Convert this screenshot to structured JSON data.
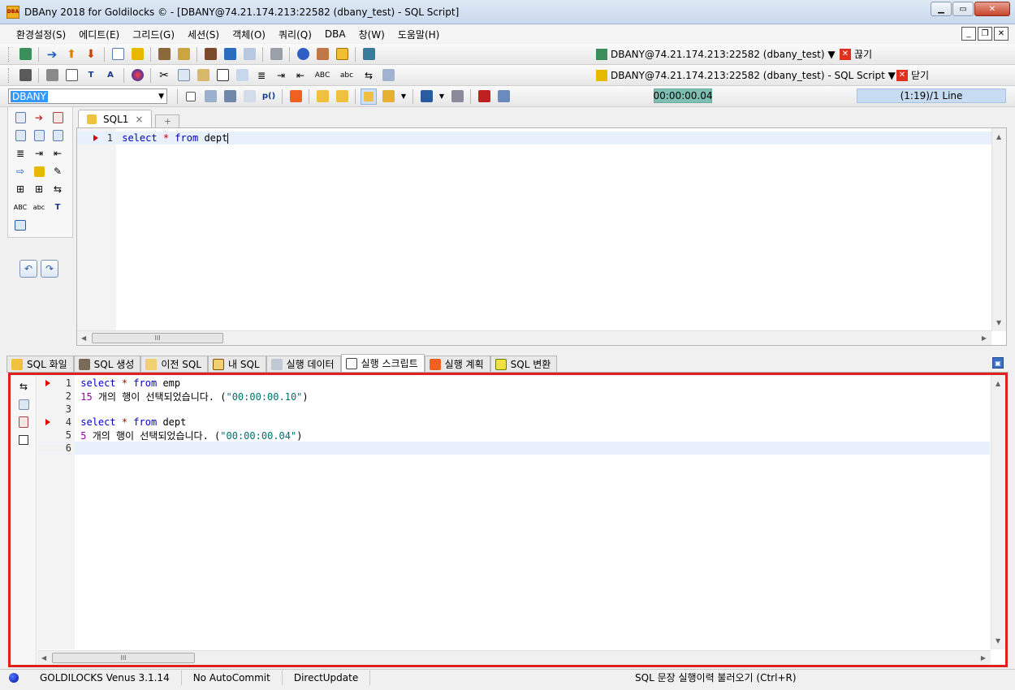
{
  "window": {
    "app_icon": "DBA",
    "title": "DBAny 2018 for Goldilocks © - [DBANY@74.21.174.213:22582 (dbany_test) - SQL Script]"
  },
  "menu": [
    "환경설정(S)",
    "에디트(E)",
    "그리드(G)",
    "세션(S)",
    "객체(O)",
    "쿼리(Q)",
    "DBA",
    "창(W)",
    "도움말(H)"
  ],
  "toolbar_right": {
    "connection": "DBANY@74.21.174.213:22582 (dbany_test) ▼",
    "disconnect": "끊기",
    "script_window": "DBANY@74.21.174.213:22582 (dbany_test) - SQL Script ▼",
    "close": "닫기"
  },
  "toolbar3": {
    "connection_combo": "DBANY",
    "elapsed_time": "00:00:00.04",
    "cursor_position": "(1:19)/1 Line"
  },
  "editor": {
    "tab_label": "SQL1",
    "tab_close": "×",
    "line_no": "1",
    "code": {
      "kw1": "select",
      "op": "*",
      "kw2": "from",
      "ident": "dept"
    }
  },
  "bottom_tabs": [
    "SQL 화일",
    "SQL 생성",
    "이전 SQL",
    "내 SQL",
    "실행 데이터",
    "실행 스크립트",
    "실행 계획",
    "SQL 변환"
  ],
  "active_bottom_tab": "실행 스크립트",
  "output": {
    "lines": [
      {
        "no": "1",
        "kw1": "select",
        "op": "*",
        "kw2": "from",
        "ident": "emp"
      },
      {
        "no": "2",
        "count": "15",
        "msg": " 개의 행이 선택되었습니다. (",
        "time": "\"00:00:00.10\"",
        "close": ")"
      },
      {
        "no": "3"
      },
      {
        "no": "4",
        "kw1": "select",
        "op": "*",
        "kw2": "from",
        "ident": "dept"
      },
      {
        "no": "5",
        "count": "5",
        "msg": " 개의 행이 선택되었습니다. (",
        "time": "\"00:00:00.04\"",
        "close": ")"
      },
      {
        "no": "6"
      }
    ]
  },
  "scroll": {
    "grip": "III"
  },
  "status": {
    "db_version": "GOLDILOCKS Venus 3.1.14",
    "commit_mode": "No AutoCommit",
    "update_mode": "DirectUpdate",
    "message": "SQL 문장 실행이력 불러오기 (Ctrl+R)"
  },
  "colors": {
    "accent_red": "#e0201c",
    "keyword": "#0000c0",
    "timer_bg": "#7fbfb3"
  }
}
